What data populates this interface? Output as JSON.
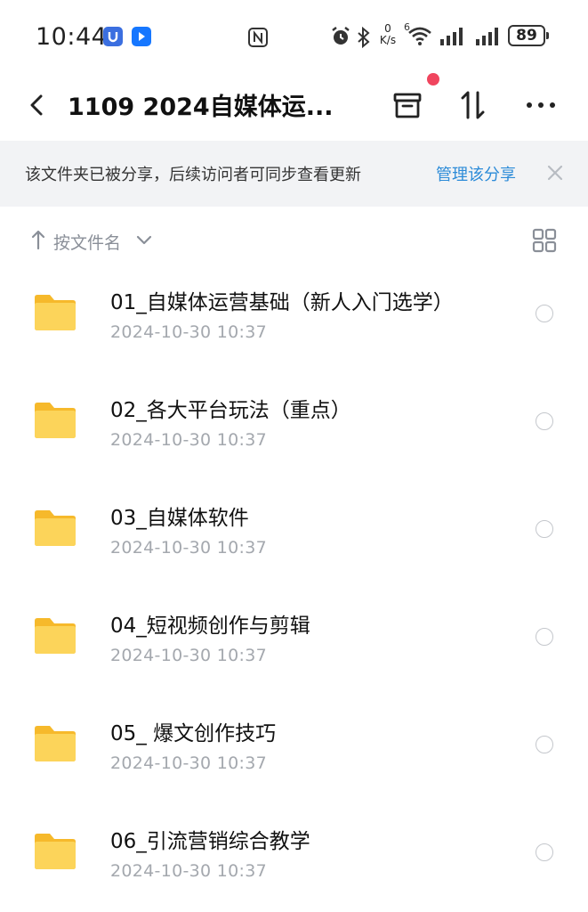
{
  "status_bar": {
    "time": "10:44",
    "net_speed_value": "0",
    "net_speed_unit": "K/s",
    "wifi_label": "6",
    "battery": "89"
  },
  "header": {
    "title": "1109 2024自媒体运..."
  },
  "share_banner": {
    "text": "该文件夹已被分享，后续访问者可同步查看更新",
    "manage_label": "管理该分享"
  },
  "sort_bar": {
    "label": "按文件名"
  },
  "files": [
    {
      "name": "01_自媒体运营基础（新人入门选学）",
      "date": "2024-10-30  10:37"
    },
    {
      "name": "02_各大平台玩法（重点）",
      "date": "2024-10-30  10:37"
    },
    {
      "name": "03_自媒体软件",
      "date": "2024-10-30  10:37"
    },
    {
      "name": "04_短视频创作与剪辑",
      "date": "2024-10-30  10:37"
    },
    {
      "name": "05_ 爆文创作技巧",
      "date": "2024-10-30  10:37"
    },
    {
      "name": "06_引流营销综合教学",
      "date": "2024-10-30  10:37"
    }
  ],
  "icons": {
    "back": "back-arrow-icon",
    "archive": "archive-box-icon",
    "sort": "transfer-arrows-icon",
    "more": "more-dots-icon",
    "close": "close-icon",
    "grid": "grid-view-icon",
    "folder": "folder-icon"
  },
  "colors": {
    "accent": "#2c8bd8",
    "notification_dot": "#f0455e",
    "banner_bg": "#f2f3f5",
    "folder": "#f9c846"
  }
}
